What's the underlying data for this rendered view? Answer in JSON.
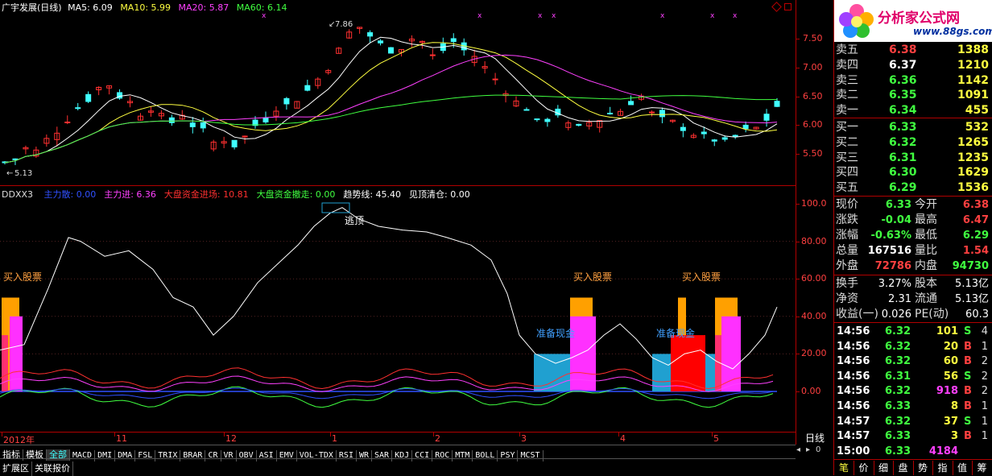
{
  "header": {
    "title": "广宇发展(日线)",
    "ma5": "MA5: 6.09",
    "ma10": "MA10: 5.99",
    "ma20": "MA20: 5.87",
    "ma60": "MA60: 6.14",
    "high_mark": "7.86",
    "low_mark": "5.13"
  },
  "price_axis": [
    "7.50",
    "7.00",
    "6.50",
    "6.00",
    "5.50"
  ],
  "indicator": {
    "name": "DDXX3",
    "items": [
      {
        "label": "主力散: 0.00",
        "color": "#3050ff"
      },
      {
        "label": "主力进: 6.36",
        "color": "#ff40ff"
      },
      {
        "label": "大盘资金进场: 10.81",
        "color": "#ff3030"
      },
      {
        "label": "大盘资金撤走: 0.00",
        "color": "#40ff40"
      },
      {
        "label": "趋势线: 45.40",
        "color": "#ffffff"
      },
      {
        "label": "见顶清仓: 0.00",
        "color": "#ffffff"
      }
    ],
    "axis": [
      "100.0",
      "80.00",
      "60.00",
      "40.00",
      "20.00",
      "0.00"
    ],
    "annotations": {
      "top": "逃顶",
      "buy1": "买入股票",
      "buy2": "买入股票",
      "buy3": "买入股票",
      "prep1": "准备现金",
      "prep2": "准备现金"
    }
  },
  "time_axis": [
    "2012年",
    "11",
    "12",
    "1",
    "2",
    "3",
    "4",
    "5"
  ],
  "period_label": "日线",
  "tabs": [
    "指标",
    "模板",
    "全部",
    "MACD",
    "DMI",
    "DMA",
    "FSL",
    "TRIX",
    "BRAR",
    "CR",
    "VR",
    "OBV",
    "ASI",
    "EMV",
    "VOL-TDX",
    "RSI",
    "WR",
    "SAR",
    "KDJ",
    "CCI",
    "ROC",
    "MTM",
    "BOLL",
    "PSY",
    "MCST"
  ],
  "bottom_tabs": [
    "扩展区",
    "关联报价"
  ],
  "logo": {
    "title": "分析家公式网",
    "url": "www.88gs.com"
  },
  "order_book": {
    "asks": [
      {
        "label": "卖五",
        "price": "6.38",
        "vol": "1388",
        "pcolor": "#ff4040"
      },
      {
        "label": "卖四",
        "price": "6.37",
        "vol": "1210",
        "pcolor": "#ffffff"
      },
      {
        "label": "卖三",
        "price": "6.36",
        "vol": "1142",
        "pcolor": "#40ff40"
      },
      {
        "label": "卖二",
        "price": "6.35",
        "vol": "1091",
        "pcolor": "#40ff40"
      },
      {
        "label": "卖一",
        "price": "6.34",
        "vol": "455",
        "pcolor": "#40ff40"
      }
    ],
    "bids": [
      {
        "label": "买一",
        "price": "6.33",
        "vol": "532",
        "pcolor": "#40ff40"
      },
      {
        "label": "买二",
        "price": "6.32",
        "vol": "1265",
        "pcolor": "#40ff40"
      },
      {
        "label": "买三",
        "price": "6.31",
        "vol": "1235",
        "pcolor": "#40ff40"
      },
      {
        "label": "买四",
        "price": "6.30",
        "vol": "1629",
        "pcolor": "#40ff40"
      },
      {
        "label": "买五",
        "price": "6.29",
        "vol": "1536",
        "pcolor": "#40ff40"
      }
    ]
  },
  "quote": [
    {
      "l1": "现价",
      "v1": "6.33",
      "c1": "#40ff40",
      "l2": "今开",
      "v2": "6.38",
      "c2": "#ff4040"
    },
    {
      "l1": "涨跌",
      "v1": "-0.04",
      "c1": "#40ff40",
      "l2": "最高",
      "v2": "6.47",
      "c2": "#ff4040"
    },
    {
      "l1": "涨幅",
      "v1": "-0.63%",
      "c1": "#40ff40",
      "l2": "最低",
      "v2": "6.29",
      "c2": "#40ff40"
    },
    {
      "l1": "总量",
      "v1": "167516",
      "c1": "#ffffff",
      "l2": "量比",
      "v2": "1.54",
      "c2": "#ff4040"
    },
    {
      "l1": "外盘",
      "v1": "72786",
      "c1": "#ff4040",
      "l2": "内盘",
      "v2": "94730",
      "c2": "#40ff40"
    }
  ],
  "fundamentals": [
    {
      "l1": "换手",
      "v1": "3.27%",
      "l2": "股本",
      "v2": "5.13亿"
    },
    {
      "l1": "净资",
      "v1": "2.31",
      "l2": "流通",
      "v2": "5.13亿"
    },
    {
      "l1": "收益(一)",
      "v1": "0.026",
      "l2": "PE(动)",
      "v2": "60.3"
    }
  ],
  "ticks": [
    {
      "time": "14:56",
      "price": "6.32",
      "vol": "101",
      "side": "S",
      "n": "4"
    },
    {
      "time": "14:56",
      "price": "6.32",
      "vol": "20",
      "side": "B",
      "n": "1"
    },
    {
      "time": "14:56",
      "price": "6.32",
      "vol": "60",
      "side": "B",
      "n": "2"
    },
    {
      "time": "14:56",
      "price": "6.31",
      "vol": "56",
      "side": "S",
      "n": "2"
    },
    {
      "time": "14:56",
      "price": "6.32",
      "vol": "918",
      "side": "B",
      "n": "2"
    },
    {
      "time": "14:56",
      "price": "6.33",
      "vol": "8",
      "side": "B",
      "n": "1"
    },
    {
      "time": "14:57",
      "price": "6.32",
      "vol": "37",
      "side": "S",
      "n": "1"
    },
    {
      "time": "14:57",
      "price": "6.33",
      "vol": "3",
      "side": "B",
      "n": "1"
    },
    {
      "time": "15:00",
      "price": "6.33",
      "vol": "4184",
      "side": "",
      "n": ""
    }
  ],
  "right_tabs": [
    "笔",
    "价",
    "细",
    "盘",
    "势",
    "指",
    "值",
    "筹"
  ],
  "colors": {
    "up": "#ff3030",
    "down": "#40ffff",
    "ma5": "#ffffff",
    "ma10": "#ffff40",
    "ma20": "#ff40ff",
    "ma60": "#40ff40",
    "border": "#b00000"
  }
}
